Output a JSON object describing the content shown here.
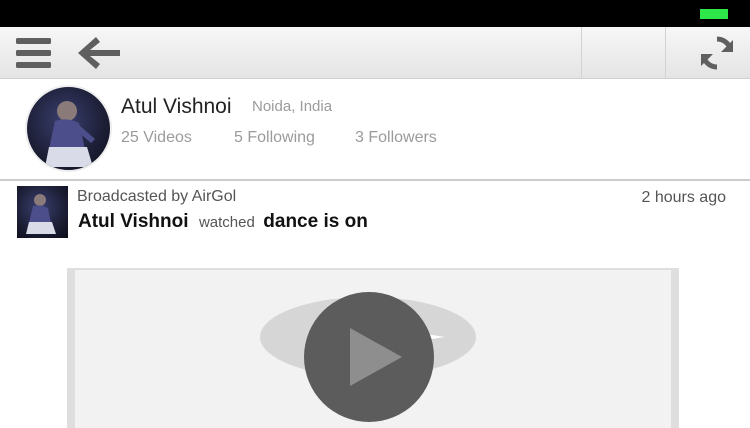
{
  "toolbar": {
    "menu_icon": "hamburger-menu-icon",
    "back_icon": "arrow-left-icon",
    "refresh_icon": "refresh-icon"
  },
  "status_bar": {
    "battery_color": "#2ee84a"
  },
  "profile": {
    "name": "Atul Vishnoi",
    "location": "Noida, India",
    "videos": "25 Videos",
    "following": "5 Following",
    "followers": "3 Followers"
  },
  "feed": [
    {
      "broadcast": "Broadcasted by AirGol",
      "time": "2 hours ago",
      "user": "Atul Vishnoi",
      "verb": "watched",
      "title": "dance is on"
    }
  ]
}
